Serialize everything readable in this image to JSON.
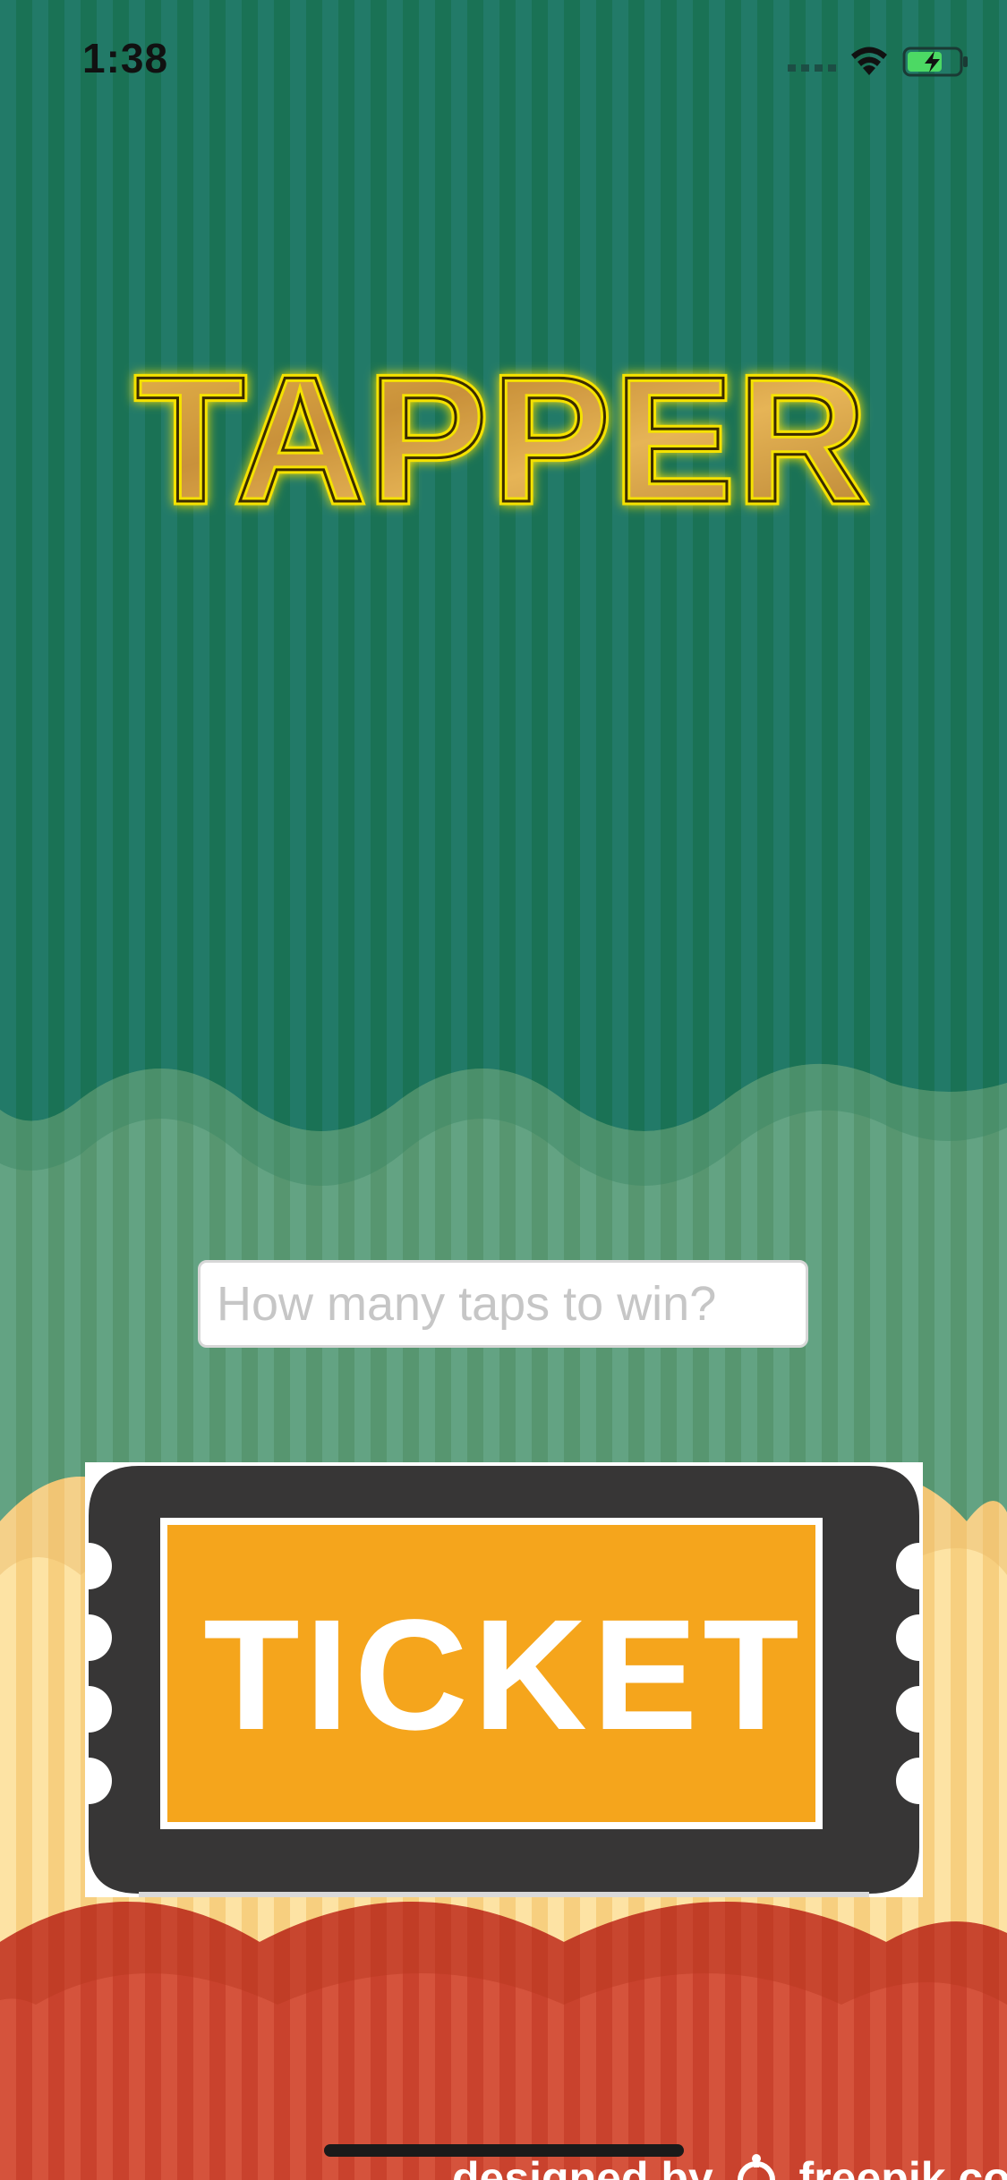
{
  "status_bar": {
    "time": "1:38",
    "icons": [
      "signal-icon",
      "wifi-icon",
      "battery-charging-icon"
    ]
  },
  "title": {
    "text": "TAPPER"
  },
  "taps_input": {
    "placeholder": "How many taps to win?",
    "value": ""
  },
  "ticket_button": {
    "label": "TICKET"
  },
  "credit": {
    "prefix": "designed by",
    "brand": "freepik.com",
    "icon": "freepik-logo-icon"
  },
  "colors": {
    "teal_curtain": "#1f7f6f",
    "sage_band": "#5e9f7c",
    "cream_band": "#fbd894",
    "red_band": "#cf4a34",
    "title_gold": "#f5e200",
    "ticket_frame": "#373636",
    "ticket_orange": "#f5a51c"
  }
}
